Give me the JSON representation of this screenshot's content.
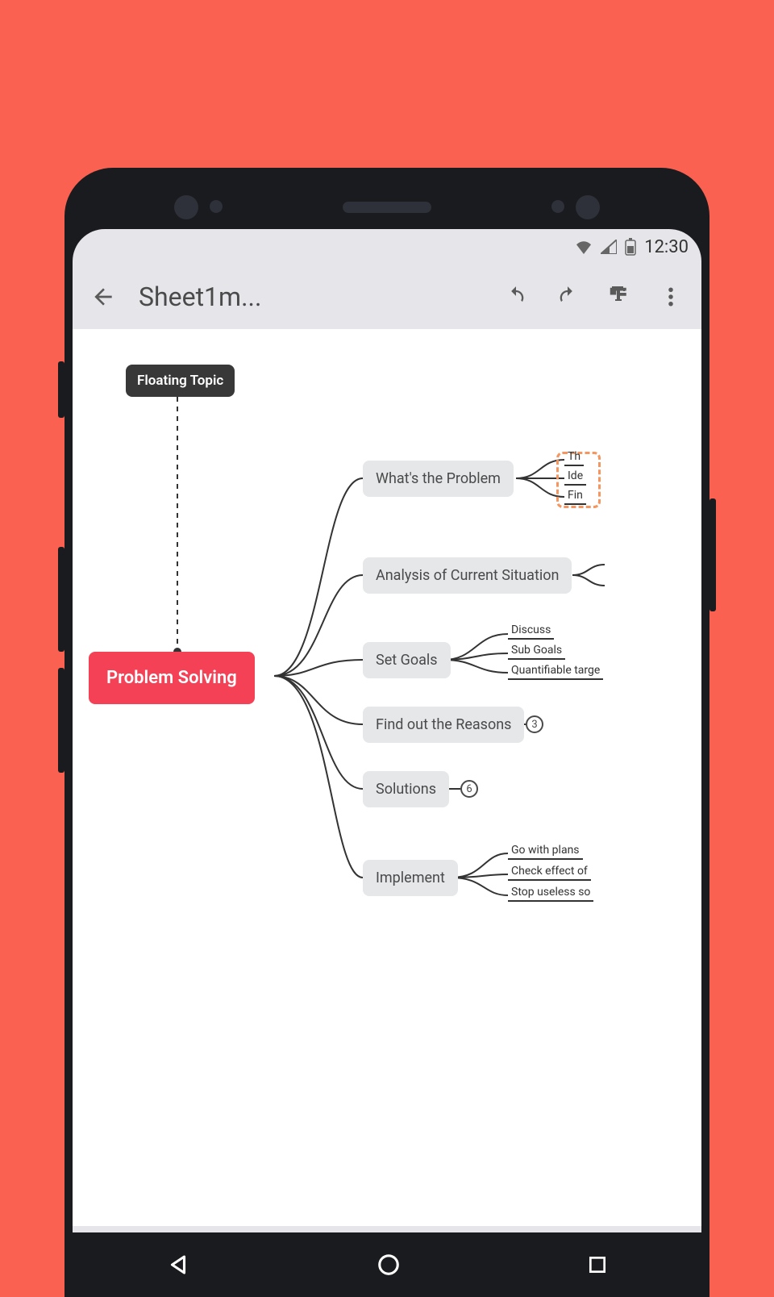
{
  "status": {
    "time": "12:30"
  },
  "toolbar": {
    "title": "Sheet1m..."
  },
  "mindmap": {
    "root": "Problem Solving",
    "floating": "Floating Topic",
    "branches": [
      {
        "label": "What's the Problem",
        "leaves": [
          "Th",
          "Ide",
          "Fin"
        ],
        "selected_leaf": 1
      },
      {
        "label": "Analysis of Current Situation"
      },
      {
        "label": "Set Goals",
        "leaves": [
          "Discuss",
          "Sub Goals",
          "Quantifiable targe"
        ]
      },
      {
        "label": "Find out the Reasons",
        "badge": "3"
      },
      {
        "label": "Solutions",
        "badge": "6"
      },
      {
        "label": "Implement",
        "leaves": [
          "Go with plans",
          "Check effect of",
          "Stop useless so"
        ]
      }
    ]
  }
}
